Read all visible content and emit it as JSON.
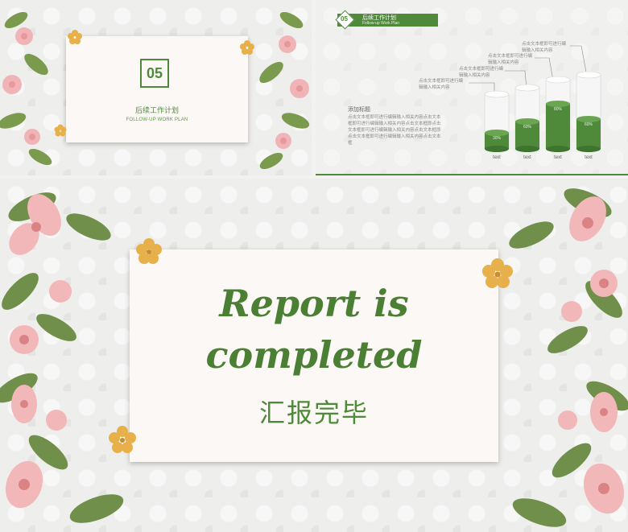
{
  "slide1": {
    "number": "05",
    "title_cn": "后续工作计划",
    "title_en": "FOLLOW-UP WORK PLAN"
  },
  "slide2": {
    "badge_number": "05",
    "header_cn": "后续工作计划",
    "header_en": "Follow-up Work Plan",
    "text_title": "添加标题",
    "text_body": "点击文本框即可进行编辑输入相关内容点击文本框即可进行编辑输入相关内容点击文本框即点击文本框即可进行编辑输入相关内容点击文本框即点击文本框即可进行编辑输入相关内容点击文本框",
    "callouts": [
      "点击文本框即可进行编辑输入相关内容",
      "点击文本框即可进行编辑输入相关内容",
      "点击文本框即可进行编辑输入相关内容",
      "点击文本框即可进行编辑输入相关内容"
    ],
    "bars": [
      {
        "label": "text",
        "value_label": "30%",
        "fill": 0.3
      },
      {
        "label": "text",
        "value_label": "60%",
        "fill": 0.45
      },
      {
        "label": "text",
        "value_label": "80%",
        "fill": 0.65
      },
      {
        "label": "text",
        "value_label": "60%",
        "fill": 0.4
      }
    ]
  },
  "slide3": {
    "title_line1": "Report is",
    "title_line2": "completed",
    "subtitle_cn": "汇报完毕"
  },
  "colors": {
    "accent_green": "#4f8a3b",
    "flower_yellow": "#e7b04a",
    "petal_pink": "#f2b7b8",
    "leaf_green": "#6f8f4a"
  }
}
